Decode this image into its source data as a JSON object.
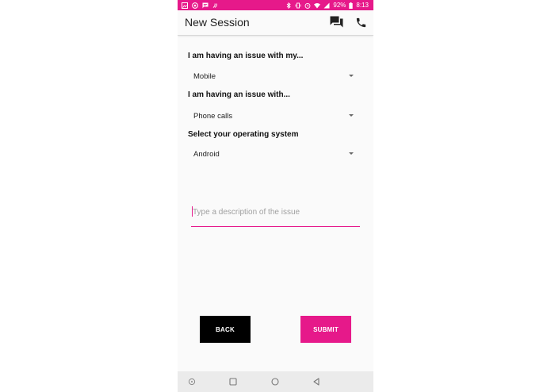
{
  "status_bar": {
    "battery": "92%",
    "time": "8:13",
    "left_icons": [
      "image-icon",
      "chrome-icon",
      "message-icon",
      "nfc-icon"
    ],
    "right_icons": [
      "bluetooth-icon",
      "vibrate-icon",
      "alarm-icon",
      "wifi-icon",
      "signal-icon",
      "battery-icon"
    ],
    "color": "#e6198a"
  },
  "app_bar": {
    "title": "New Session",
    "actions": [
      "chat-icon",
      "phone-icon"
    ]
  },
  "form": {
    "device_label": "I am having an issue with my...",
    "device_value": "Mobile",
    "issue_label": "I am having an issue with...",
    "issue_value": "Phone calls",
    "os_label": "Select your operating system",
    "os_value": "Android",
    "description_placeholder": "Type a description of the issue",
    "description_value": ""
  },
  "buttons": {
    "back_label": "BACK",
    "submit_label": "SUBMIT"
  },
  "nav_bar": {
    "icons": [
      "assistant-icon",
      "recents-icon",
      "home-icon",
      "back-icon"
    ]
  },
  "colors": {
    "accent": "#e6198a",
    "back_button": "#000000",
    "background": "#fafafa"
  }
}
